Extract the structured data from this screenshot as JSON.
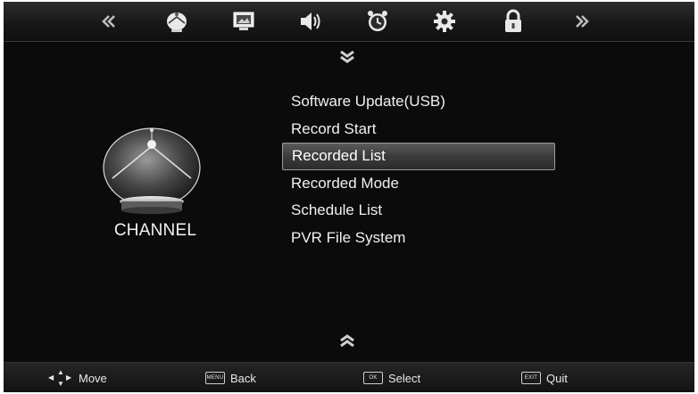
{
  "top_menu": {
    "items": [
      {
        "icon": "double-chevron-left-icon"
      },
      {
        "icon": "satellite-dish-icon"
      },
      {
        "icon": "picture-icon"
      },
      {
        "icon": "speaker-icon"
      },
      {
        "icon": "alarm-clock-icon"
      },
      {
        "icon": "gear-icon"
      },
      {
        "icon": "lock-icon"
      },
      {
        "icon": "double-chevron-right-icon"
      }
    ]
  },
  "category": {
    "label": "CHANNEL",
    "icon": "satellite-dish-icon"
  },
  "menu": {
    "items": [
      {
        "label": "Software Update(USB)"
      },
      {
        "label": "Record Start"
      },
      {
        "label": "Recorded List",
        "selected": true
      },
      {
        "label": "Recorded Mode"
      },
      {
        "label": "Schedule List"
      },
      {
        "label": "PVR File System"
      }
    ],
    "scroll_up_icon": "chevron-up-icon",
    "scroll_down_icon": "chevron-down-icon"
  },
  "bottom_bar": {
    "move": {
      "label": "Move"
    },
    "back": {
      "key": "MENU",
      "label": "Back"
    },
    "select": {
      "key": "OK",
      "label": "Select"
    },
    "quit": {
      "key": "EXIT",
      "label": "Quit"
    }
  },
  "colors": {
    "background": "#0b0b0b",
    "text": "#f0f0f0",
    "highlight_border": "#9a9a9a"
  }
}
